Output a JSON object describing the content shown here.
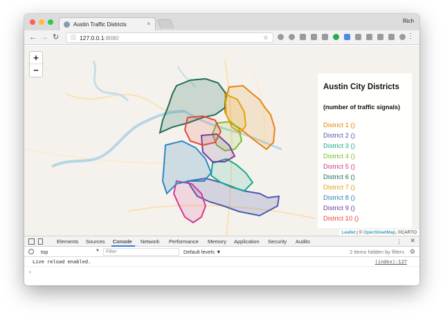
{
  "browser": {
    "tab_title": "Austin Traffic Districts",
    "tab_close": "×",
    "user_name": "Rich",
    "url_host": "127.0.0.1",
    "url_port": ":8080",
    "info_icon": "info-circle-icon",
    "star_icon": "star-icon",
    "back": "←",
    "forward": "→",
    "reload": "↻",
    "menu": "⋮",
    "colors": {
      "close": "#fc605c",
      "minimize": "#fdbc40",
      "maximize": "#34c84a"
    }
  },
  "map": {
    "zoom_in": "+",
    "zoom_out": "−",
    "legend": {
      "title": "Austin City Districts",
      "subtitle": "(number of traffic signals)",
      "items": [
        {
          "label": "District 1 ()",
          "color": "#e6830e"
        },
        {
          "label": "District 2 ()",
          "color": "#4a5ab0"
        },
        {
          "label": "District 3 ()",
          "color": "#1aa98a"
        },
        {
          "label": "District 4 ()",
          "color": "#7cbb2c"
        },
        {
          "label": "District 5 ()",
          "color": "#d6368f"
        },
        {
          "label": "District 6 ()",
          "color": "#1f6d5c"
        },
        {
          "label": "District 7 ()",
          "color": "#e0a409"
        },
        {
          "label": "District 8 ()",
          "color": "#2c86c0"
        },
        {
          "label": "District 9 ()",
          "color": "#6a3f9e"
        },
        {
          "label": "District 10 ()",
          "color": "#e5483c"
        }
      ]
    },
    "attribution": {
      "leaflet": "Leaflet",
      "sep": " | © ",
      "osm": "OpenStreetMap",
      "carto": ", ©CARTO"
    }
  },
  "devtools": {
    "tabs": [
      "Elements",
      "Sources",
      "Console",
      "Network",
      "Performance",
      "Memory",
      "Application",
      "Security",
      "Audits"
    ],
    "active_tab": "Console",
    "context": "top",
    "filter_placeholder": "Filter",
    "levels": "Default levels ▼",
    "hidden_count": "2 items hidden by filters",
    "log_message": "Live reload enabled.",
    "log_source": "(index):127",
    "prompt": "›",
    "close": "✕",
    "menu": "⋮",
    "gear_icon": "gear-icon"
  }
}
